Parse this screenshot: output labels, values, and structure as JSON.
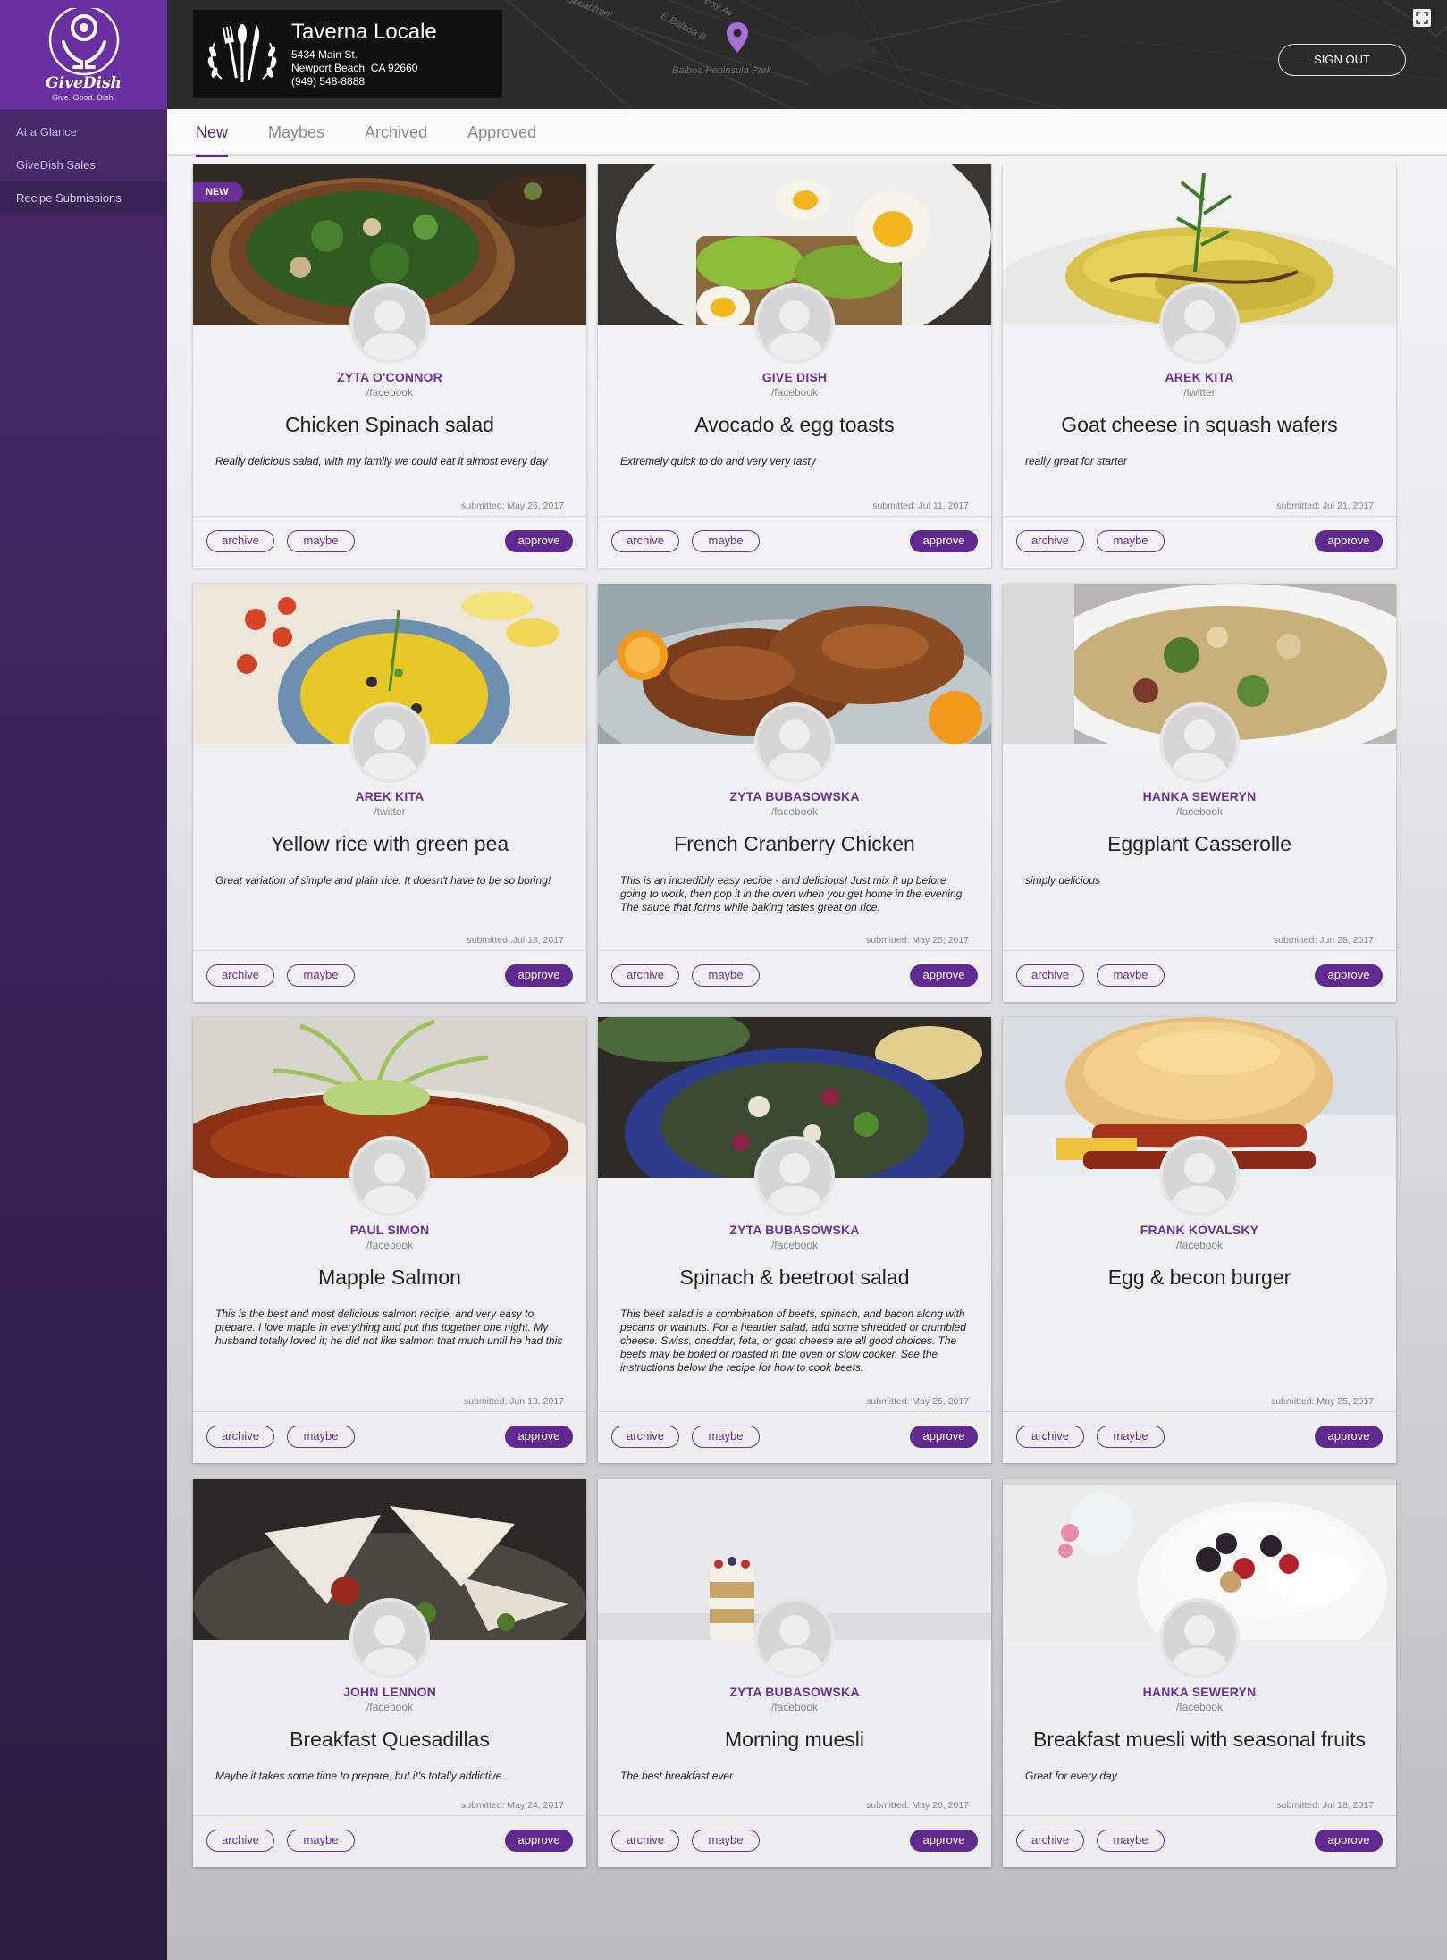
{
  "brand": {
    "name": "GiveDish",
    "tagline": "Give. Good. Dish."
  },
  "sidebar": {
    "items": [
      {
        "label": "At a Glance"
      },
      {
        "label": "GiveDish Sales"
      },
      {
        "label": "Recipe Submissions"
      }
    ]
  },
  "restaurant": {
    "name": "Taverna Locale",
    "address1": "5434 Main St.",
    "address2": "Newport Beach, CA 92660",
    "phone": "(949) 548-8888"
  },
  "map": {
    "label_park": "Balboa Peninsula Park",
    "label_street": "E Balboa B",
    "label_front": "Oceanfront",
    "label_bay": "Bay Av"
  },
  "header": {
    "signout_label": "SIGN OUT"
  },
  "tabs": [
    {
      "label": "New"
    },
    {
      "label": "Maybes"
    },
    {
      "label": "Archived"
    },
    {
      "label": "Approved"
    }
  ],
  "actions": {
    "archive": "archive",
    "maybe": "maybe",
    "approve": "approve"
  },
  "badge_new": "NEW",
  "cards": [
    {
      "author": "ZYTA O'CONNOR",
      "source": "/facebook",
      "title": "Chicken Spinach salad",
      "description": "Really delicious salad, with my family we could eat it almost every day",
      "submitted": "submitted: May 26, 2017",
      "photo": "salad"
    },
    {
      "author": "GIVE DISH",
      "source": "/facebook",
      "title": "Avocado & egg toasts",
      "description": "Extremely quick to do and very very tasty",
      "submitted": "submitted: Jul 11, 2017",
      "photo": "avocado"
    },
    {
      "author": "AREK KITA",
      "source": "/twitter",
      "title": "Goat cheese in squash wafers",
      "description": "really great for starter",
      "submitted": "submitted: Jul 21, 2017",
      "photo": "squash"
    },
    {
      "author": "AREK KITA",
      "source": "/twitter",
      "title": "Yellow rice with green pea",
      "description": "Great variation of simple and plain rice. It doesn't have to be so boring!",
      "submitted": "submitted: Jul 18, 2017",
      "photo": "rice"
    },
    {
      "author": "ZYTA BUBASOWSKA",
      "source": "/facebook",
      "title": "French Cranberry Chicken",
      "description": "This is an incredibly easy recipe - and delicious! Just mix it up before going to work, then pop it in the oven when you get home in the evening. The sauce that forms while baking tastes great on rice.",
      "submitted": "submitted: May 25, 2017",
      "photo": "chicken"
    },
    {
      "author": "HANKA SEWERYN",
      "source": "/facebook",
      "title": "Eggplant Casserolle",
      "description": "simply delicious",
      "submitted": "submitted: Jun 28, 2017",
      "photo": "casserole"
    },
    {
      "author": "PAUL SIMON",
      "source": "/facebook",
      "title": "Mapple Salmon",
      "description": "This is the best and most delicious salmon recipe, and very easy to prepare. I love maple in everything and put this together one night. My husband totally loved it; he did not like salmon that much until he had this",
      "submitted": "submitted: Jun 13, 2017",
      "photo": "salmon"
    },
    {
      "author": "ZYTA BUBASOWSKA",
      "source": "/facebook",
      "title": "Spinach & beetroot salad",
      "description": "This beet salad is a combination of beets, spinach, and bacon along with pecans or walnuts. For a heartier salad, add some shredded or crumbled cheese. Swiss, cheddar, feta, or goat cheese are all good choices. The beets may be boiled or roasted in the oven or slow cooker. See the instructions below the recipe for how to cook beets.",
      "submitted": "submitted: May 25, 2017",
      "photo": "beet"
    },
    {
      "author": "FRANK KOVALSKY",
      "source": "/facebook",
      "title": "Egg & becon burger",
      "description": "",
      "submitted": "submitted: May 25, 2017",
      "photo": "burger"
    },
    {
      "author": "JOHN LENNON",
      "source": "/facebook",
      "title": "Breakfast Quesadillas",
      "description": "Maybe it takes some time to prepare, but it's totally addictive",
      "submitted": "submitted: May 24, 2017",
      "photo": "quesadilla"
    },
    {
      "author": "ZYTA BUBASOWSKA",
      "source": "/facebook",
      "title": "Morning muesli",
      "description": "The best breakfast ever",
      "submitted": "submitted: May 26, 2017",
      "photo": "muesli"
    },
    {
      "author": "HANKA SEWERYN",
      "source": "/facebook",
      "title": "Breakfast muesli with seasonal fruits",
      "description": "Great for every day",
      "submitted": "submitted: Jul 18, 2017",
      "photo": "berries"
    }
  ]
}
